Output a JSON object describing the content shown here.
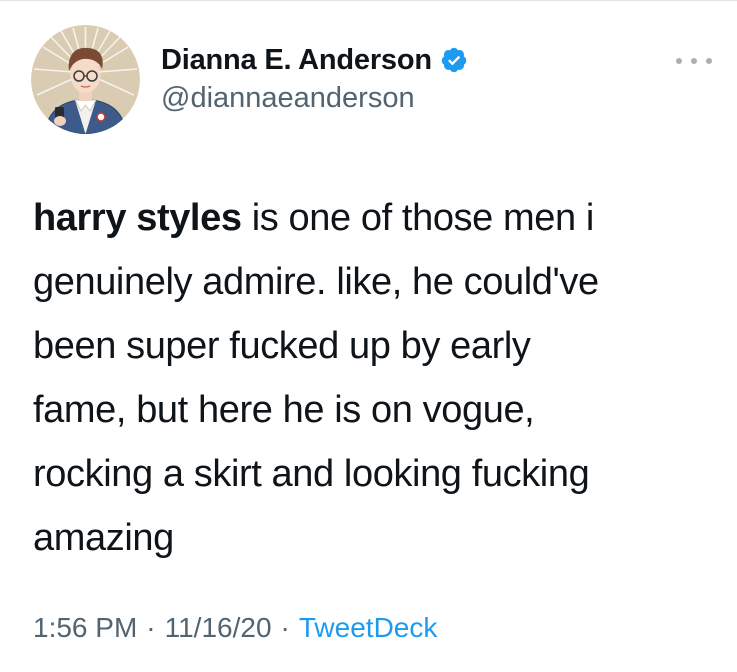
{
  "author": {
    "display_name": "Dianna E. Anderson",
    "handle": "@diannaeanderson",
    "verified": true,
    "avatar_icon": "illustrated-portrait-avatar"
  },
  "tweet": {
    "lead_bold": "harry styles",
    "first_line_rest": " is one of those men i",
    "lines": [
      "genuinely admire. like, he could've",
      "been super fucked up by early",
      "fame, but here he is on vogue,",
      "rocking a skirt and looking fucking",
      "amazing"
    ]
  },
  "meta": {
    "time": "1:56 PM",
    "separator": "·",
    "date": "11/16/20",
    "source": "TweetDeck"
  },
  "icons": {
    "verified": "verified-badge-icon",
    "more": "more-options-icon"
  },
  "colors": {
    "text": "#0f1419",
    "secondary": "#536471",
    "accent": "#1d9bf0",
    "avatar_bg": "#d9ccb2"
  }
}
